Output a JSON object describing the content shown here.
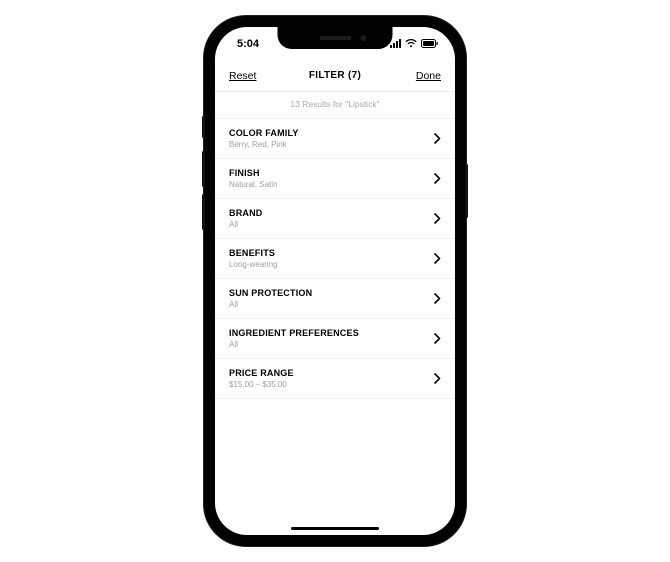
{
  "statusbar": {
    "time": "5:04"
  },
  "nav": {
    "reset": "Reset",
    "title": "FILTER (7)",
    "done": "Done"
  },
  "results_hint": "13 Results for \"Lipstick\"",
  "filters": [
    {
      "title": "COLOR FAMILY",
      "sub": "Berry, Red, Pink"
    },
    {
      "title": "FINISH",
      "sub": "Natural, Satin"
    },
    {
      "title": "BRAND",
      "sub": "All"
    },
    {
      "title": "BENEFITS",
      "sub": "Long-wearing"
    },
    {
      "title": "SUN PROTECTION",
      "sub": "All"
    },
    {
      "title": "INGREDIENT PREFERENCES",
      "sub": "All"
    },
    {
      "title": "PRICE RANGE",
      "sub": "$15.00 – $35.00"
    }
  ]
}
